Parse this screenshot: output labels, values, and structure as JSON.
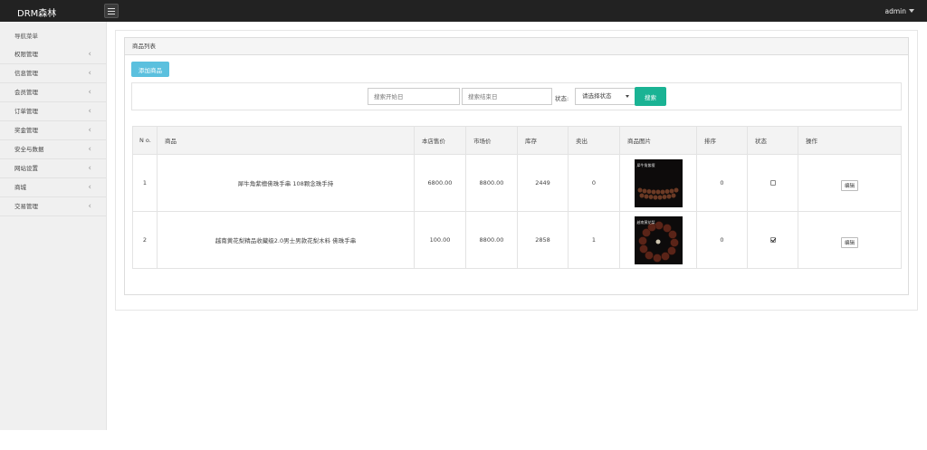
{
  "topbar": {
    "brand": "DRM森林",
    "menu_icon": "hamburger-icon",
    "user": "admin"
  },
  "sidebar": {
    "heading": "导航菜单",
    "items": [
      {
        "label": "权限管理"
      },
      {
        "label": "信息管理"
      },
      {
        "label": "会员管理"
      },
      {
        "label": "订单管理"
      },
      {
        "label": "奖金管理"
      },
      {
        "label": "安全与数据"
      },
      {
        "label": "网站设置"
      },
      {
        "label": "商城"
      },
      {
        "label": "交易管理"
      }
    ]
  },
  "panel": {
    "title": "商品列表",
    "add_label": "添加商品"
  },
  "search": {
    "start_placeholder": "搜索开始日",
    "end_placeholder": "搜索结束日",
    "status_label": "状态:",
    "status_selected": "请选择状态",
    "button_label": "搜索"
  },
  "table": {
    "headers": {
      "no": "N o.",
      "product": "商品",
      "price": "本店售价",
      "market": "市场价",
      "stock": "库存",
      "sold": "卖出",
      "image": "商品图片",
      "sort": "排序",
      "status": "状态",
      "ops": "操作"
    },
    "rows": [
      {
        "no": "1",
        "name": "犀牛角紫檀佛珠手串 108颗念珠手持",
        "price": "6800.00",
        "market": "8800.00",
        "stock": "2449",
        "sold": "0",
        "image_label": "犀牛角紫檀",
        "sort": "0",
        "status_checked": false,
        "edit": "编辑"
      },
      {
        "no": "2",
        "name": "越南黄花梨精品收藏级2.0男士男款花梨木料 佛珠手串",
        "price": "100.00",
        "market": "8800.00",
        "stock": "2858",
        "sold": "1",
        "image_label": "越南黄花梨",
        "sort": "0",
        "status_checked": true,
        "edit": "编辑"
      }
    ]
  },
  "colors": {
    "primary": "#1ab394",
    "info": "#5bc0de",
    "topbar": "#222222"
  }
}
